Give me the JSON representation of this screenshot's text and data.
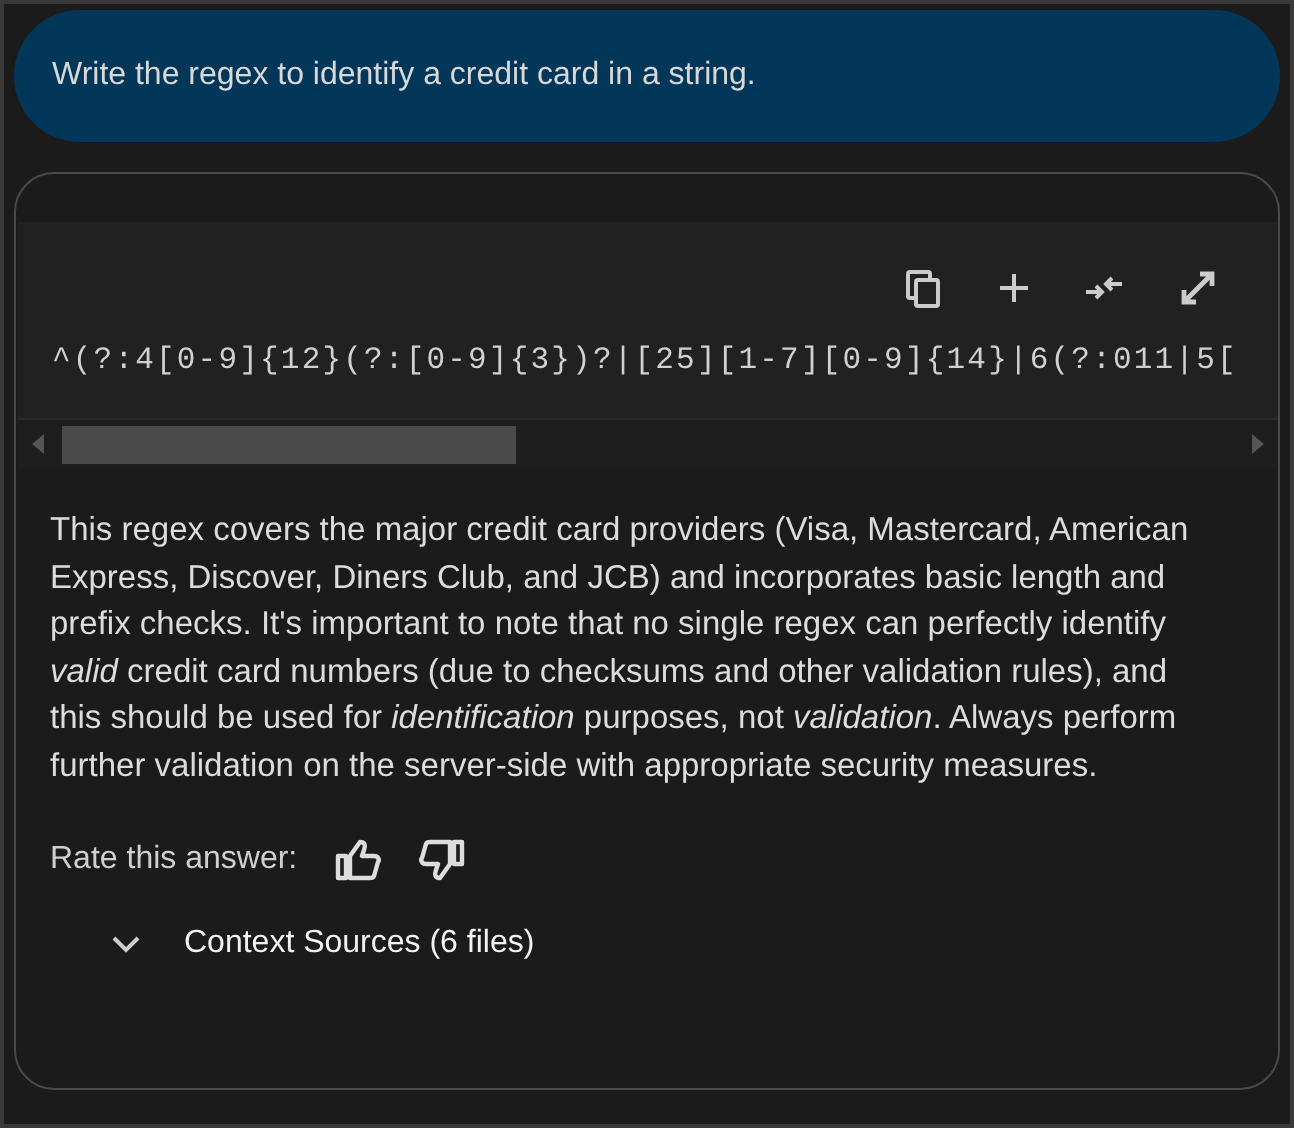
{
  "question": "Write the regex to identify a credit card in a string.",
  "code": {
    "text": "^(?:4[0-9]{12}(?:[0-9]{3})?|[25][1-7][0-9]{14}|6(?:011|5["
  },
  "answer": "This regex covers the major credit card providers (Visa, Mastercard, American Express, Discover, Diners Club, and JCB) and incorporates basic length and prefix checks. It's important to note that no single regex can perfectly identify *valid* credit card numbers (due to checksums and other validation rules), and this should be used for *identification* purposes, not *validation*. Always perform further validation on the server-side with appropriate security measures.",
  "rating": {
    "label": "Rate this answer:"
  },
  "context_sources": {
    "label": "Context Sources (6 files)",
    "expanded": false
  }
}
